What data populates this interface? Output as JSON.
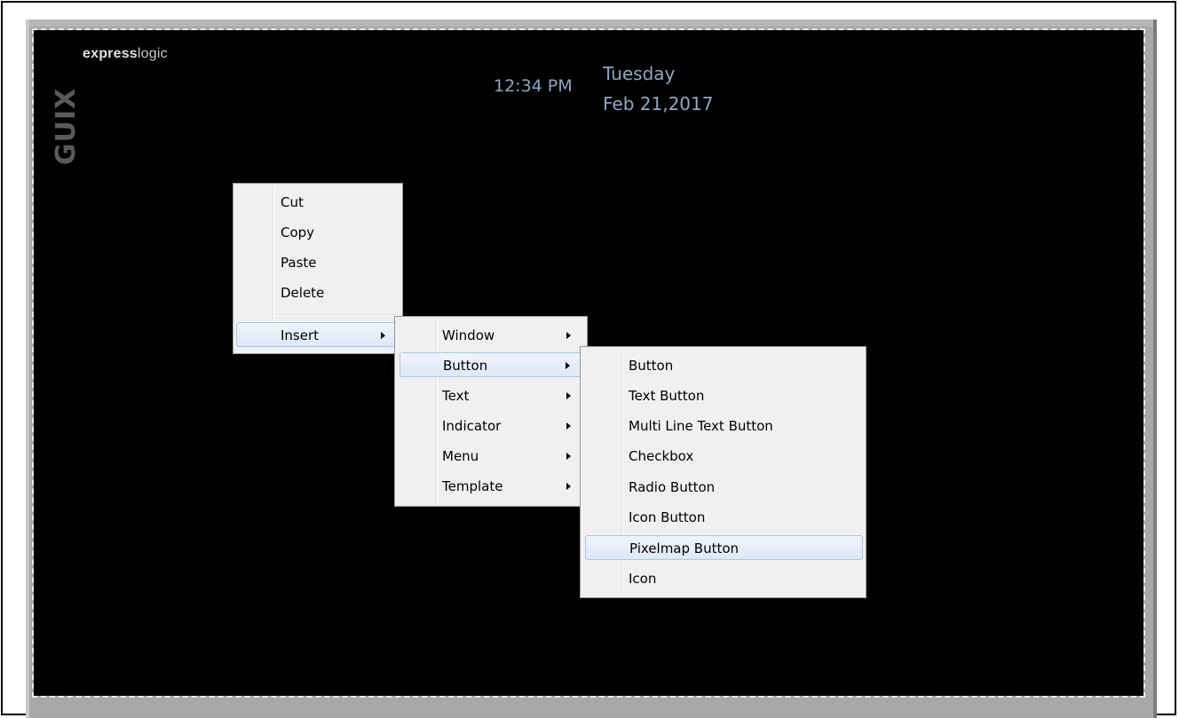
{
  "canvas": {
    "logo_bold": "express",
    "logo_light": "logic",
    "logo_vertical": "GUIX",
    "time": "12:34 PM",
    "day": "Tuesday",
    "date": "Feb 21,2017"
  },
  "menu_main": {
    "items": [
      {
        "label": "Cut"
      },
      {
        "label": "Copy"
      },
      {
        "label": "Paste"
      },
      {
        "label": "Delete"
      },
      {
        "label": "Insert",
        "submenu": true,
        "highlighted": true
      }
    ]
  },
  "menu_insert": {
    "items": [
      {
        "label": "Window",
        "submenu": true
      },
      {
        "label": "Button",
        "submenu": true,
        "highlighted": true
      },
      {
        "label": "Text",
        "submenu": true
      },
      {
        "label": "Indicator",
        "submenu": true
      },
      {
        "label": "Menu",
        "submenu": true
      },
      {
        "label": "Template",
        "submenu": true
      }
    ]
  },
  "menu_button": {
    "items": [
      {
        "label": "Button"
      },
      {
        "label": "Text Button"
      },
      {
        "label": "Multi Line Text Button"
      },
      {
        "label": "Checkbox"
      },
      {
        "label": "Radio Button"
      },
      {
        "label": "Icon Button"
      },
      {
        "label": "Pixelmap Button",
        "highlighted": true
      },
      {
        "label": "Icon"
      }
    ]
  },
  "colors": {
    "canvas_bg": "#000000",
    "clock_text": "#8ea6c2",
    "menu_bg": "#f0f0f0",
    "highlight_border": "#a8c8ea"
  }
}
